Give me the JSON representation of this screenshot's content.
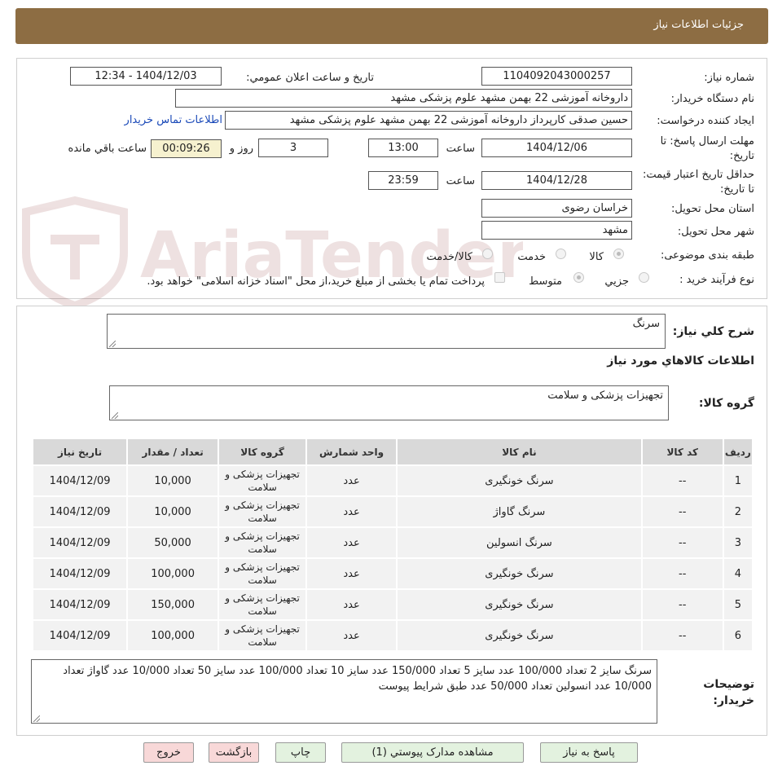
{
  "header": {
    "title": "جزئیات اطلاعات نیاز"
  },
  "watermark": {
    "text": "AriaTender.neT"
  },
  "form": {
    "need_number_label": "شماره نیاز:",
    "need_number": "1104092043000257",
    "announce_label": "تاریخ و ساعت اعلان عمومي:",
    "announce_value": "1404/12/03 - 12:34",
    "buyer_org_label": "نام دستگاه خریدار:",
    "buyer_org": "داروخانه آموزشی 22 بهمن مشهد   علوم پزشکی مشهد",
    "requester_label": "ایجاد کننده درخواست:",
    "requester": "حسین صدقی کارپرداز داروخانه آموزشی 22 بهمن مشهد   علوم پزشکی مشهد",
    "contact_link": "اطلاعات تماس خریدار",
    "deadline_label": "مهلت ارسال پاسخ: تا تاریخ:",
    "deadline_date": "1404/12/06",
    "time_label": "ساعت",
    "deadline_time": "13:00",
    "days_value": "3",
    "days_label": "روز و",
    "remaining_value": "00:09:26",
    "remaining_label": "ساعت باقي مانده",
    "validity_label": "حداقل تاریخ اعتبار قیمت: تا تاریخ:",
    "validity_date": "1404/12/28",
    "validity_time": "23:59",
    "province_label": "استان محل تحویل:",
    "province": "خراسان رضوی",
    "city_label": "شهر محل تحویل:",
    "city": "مشهد",
    "category_label": "طبقه بندی موضوعی:",
    "category_options": [
      "کالا",
      "خدمت",
      "کالا/خدمت"
    ],
    "process_label": "نوع فرآیند خرید :",
    "process_options": [
      "جزیي",
      "متوسط"
    ],
    "payment_note": "پرداخت تمام یا بخشی از مبلغ خرید،از محل \"اسناد خزانه اسلامی\" خواهد بود."
  },
  "summary": {
    "general_label": "شرح کلي نیاز:",
    "general_value": "سرنگ",
    "items_title": "اطلاعات کالاهاي مورد نیاز",
    "group_label": "گروه کالا:",
    "group_value": "تجهیزات پزشکی و سلامت"
  },
  "table": {
    "headers": [
      "ردیف",
      "کد کالا",
      "نام کالا",
      "واحد شمارش",
      "گروه کالا",
      "تعداد / مقدار",
      "تاریخ نیاز"
    ],
    "rows": [
      [
        "1",
        "--",
        "سرنگ خونگیری",
        "عدد",
        "تجهیزات پزشکی و سلامت",
        "10,000",
        "1404/12/09"
      ],
      [
        "2",
        "--",
        "سرنگ گاواژ",
        "عدد",
        "تجهیزات پزشکی و سلامت",
        "10,000",
        "1404/12/09"
      ],
      [
        "3",
        "--",
        "سرنگ انسولین",
        "عدد",
        "تجهیزات پزشکی و سلامت",
        "50,000",
        "1404/12/09"
      ],
      [
        "4",
        "--",
        "سرنگ خونگیری",
        "عدد",
        "تجهیزات پزشکی و سلامت",
        "100,000",
        "1404/12/09"
      ],
      [
        "5",
        "--",
        "سرنگ خونگیری",
        "عدد",
        "تجهیزات پزشکی و سلامت",
        "150,000",
        "1404/12/09"
      ],
      [
        "6",
        "--",
        "سرنگ خونگیری",
        "عدد",
        "تجهیزات پزشکی و سلامت",
        "100,000",
        "1404/12/09"
      ]
    ]
  },
  "buyer_notes": {
    "label": "توضیحات خریدار:",
    "text": "سرنگ سایز 2 تعداد 100/000 عدد سایز 5 تعداد 150/000 عدد سایز 10 تعداد 100/000 عدد سایز 50 تعداد 10/000 عدد گاواژ تعداد 10/000 عدد انسولین تعداد 50/000 عدد طبق شرایط پیوست"
  },
  "buttons": {
    "reply": "پاسخ به نیاز",
    "attachments": "مشاهده مدارک پیوستي (1)",
    "print": "چاپ",
    "back": "بازگشت",
    "exit": "خروج"
  }
}
